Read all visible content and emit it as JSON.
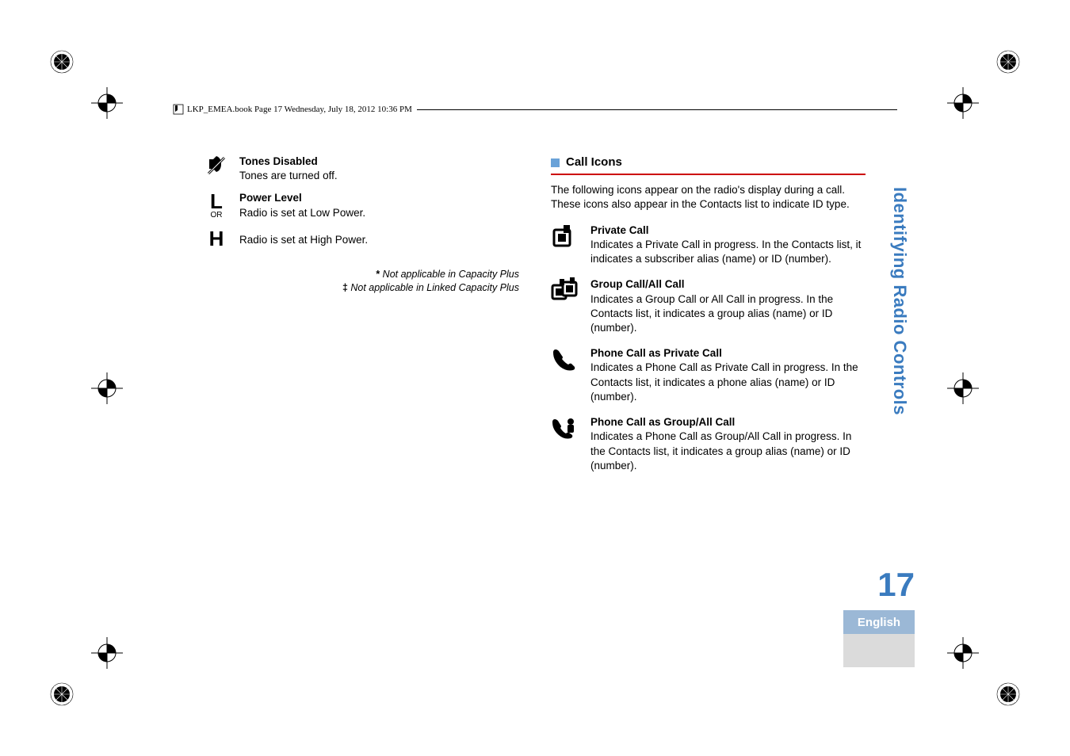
{
  "header": {
    "file_info": "LKP_EMEA.book  Page 17  Wednesday, July 18, 2012  10:36 PM"
  },
  "left_column": {
    "tones_disabled": {
      "title": "Tones Disabled",
      "desc": "Tones are turned off."
    },
    "power_level": {
      "title": "Power Level",
      "low": "Radio is set at Low Power.",
      "or_label": "OR",
      "high": "Radio is set at High Power."
    },
    "footnotes": {
      "line1": "Not applicable in Capacity Plus",
      "line2": "Not applicable in Linked Capacity Plus",
      "star": "*",
      "dagger": "‡"
    }
  },
  "right_column": {
    "section_title": "Call Icons",
    "intro": "The following icons appear on the radio's display during a call. These icons also appear in the Contacts list to indicate ID type.",
    "private_call": {
      "title": "Private Call",
      "desc": "Indicates a Private Call in progress. In the Contacts list, it indicates a subscriber alias (name) or ID (number)."
    },
    "group_call": {
      "title": "Group Call/All Call",
      "desc": "Indicates a Group Call or All Call in progress. In the Contacts list, it indicates a group alias (name) or ID (number)."
    },
    "phone_private": {
      "title": "Phone Call as Private Call",
      "desc": "Indicates a Phone Call as Private Call in progress. In the Contacts list, it indicates a phone alias (name) or ID (number)."
    },
    "phone_group": {
      "title": "Phone Call as Group/All Call",
      "desc": "Indicates a Phone Call as Group/All Call in progress. In the Contacts list, it indicates a group alias (name) or ID (number)."
    }
  },
  "side": {
    "section_label": "Identifying Radio Controls",
    "page_number": "17",
    "language": "English"
  }
}
